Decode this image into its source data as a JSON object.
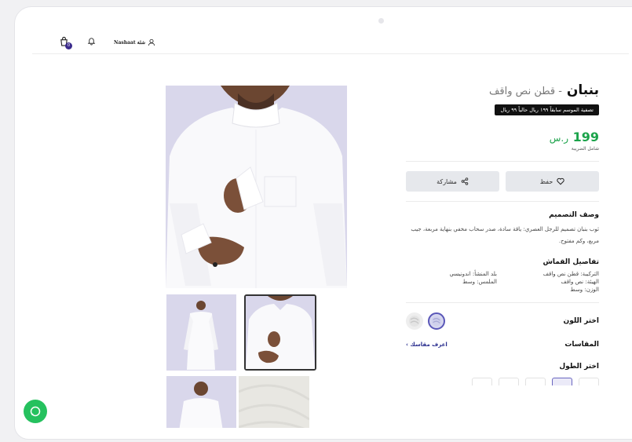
{
  "header": {
    "user_name": "Nashaat شلة",
    "cart_count": "0"
  },
  "product": {
    "name": "بنبان",
    "subtitle": "- قطن نص واقف",
    "promo": "تصفية الموسم سابقاً ١٩٩ ريال حالياً ٩٩ ريال",
    "price": "199",
    "currency": "ر.س",
    "tax_note": "شامل الضريبة",
    "save_label": "حفظ",
    "share_label": "مشاركة"
  },
  "design": {
    "heading": "وصف التصميم",
    "text": "ثوب بنبان تصميم للرجل العصري: ياقة سادة، صدر سحاب مخفي بنهاية مربعة، جيب مربع، وكم مفتوح."
  },
  "fabric": {
    "heading": "تفاصيل القماش",
    "composition": "التركيبة: قطن نص واقف",
    "origin": "بلد المنشأ: اندونيسي",
    "body": "الهيئة: نص واقف",
    "texture": "الملمس: وسط",
    "weight": "الوزن: وسط"
  },
  "color": {
    "label": "اختر اللون"
  },
  "sizes": {
    "label": "المقاسات",
    "guide_link": "اعرف مقاسك ›"
  },
  "length": {
    "label": "اختر الطول",
    "selected_index": 1
  },
  "colors": {
    "accent": "#1ba34a",
    "brand": "#3b2b8c",
    "whatsapp": "#25c15e"
  }
}
